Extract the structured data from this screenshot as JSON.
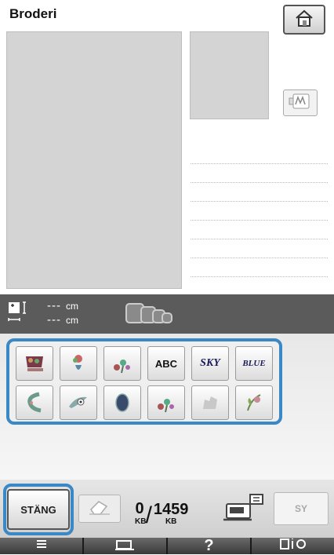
{
  "header": {
    "title": "Broderi"
  },
  "size": {
    "height_value": "---",
    "width_value": "---",
    "unit": "cm"
  },
  "patterns": [
    {
      "name": "pattern-floral-sign",
      "kind": "img"
    },
    {
      "name": "pattern-vase",
      "kind": "img"
    },
    {
      "name": "pattern-flowers",
      "kind": "img"
    },
    {
      "name": "pattern-abc-font",
      "kind": "text",
      "label": "ABC"
    },
    {
      "name": "pattern-sky-font",
      "kind": "script",
      "label": "SKY"
    },
    {
      "name": "pattern-blue-font",
      "kind": "script",
      "label": "BLUE"
    },
    {
      "name": "pattern-border",
      "kind": "img"
    },
    {
      "name": "pattern-bird",
      "kind": "img"
    },
    {
      "name": "pattern-oval",
      "kind": "img"
    },
    {
      "name": "pattern-flowers-2",
      "kind": "img"
    },
    {
      "name": "pattern-disabled",
      "kind": "img"
    },
    {
      "name": "pattern-flower-leaf",
      "kind": "img"
    }
  ],
  "footer": {
    "close_label": "STÄNG",
    "memory_used": "0",
    "memory_total": "1459",
    "memory_unit": "KB",
    "sew_label": "SY"
  },
  "tabs": [
    "≡",
    "",
    "?",
    "i"
  ],
  "colors": {
    "accent": "#3b88c6",
    "bar": "#5b5b5b"
  }
}
